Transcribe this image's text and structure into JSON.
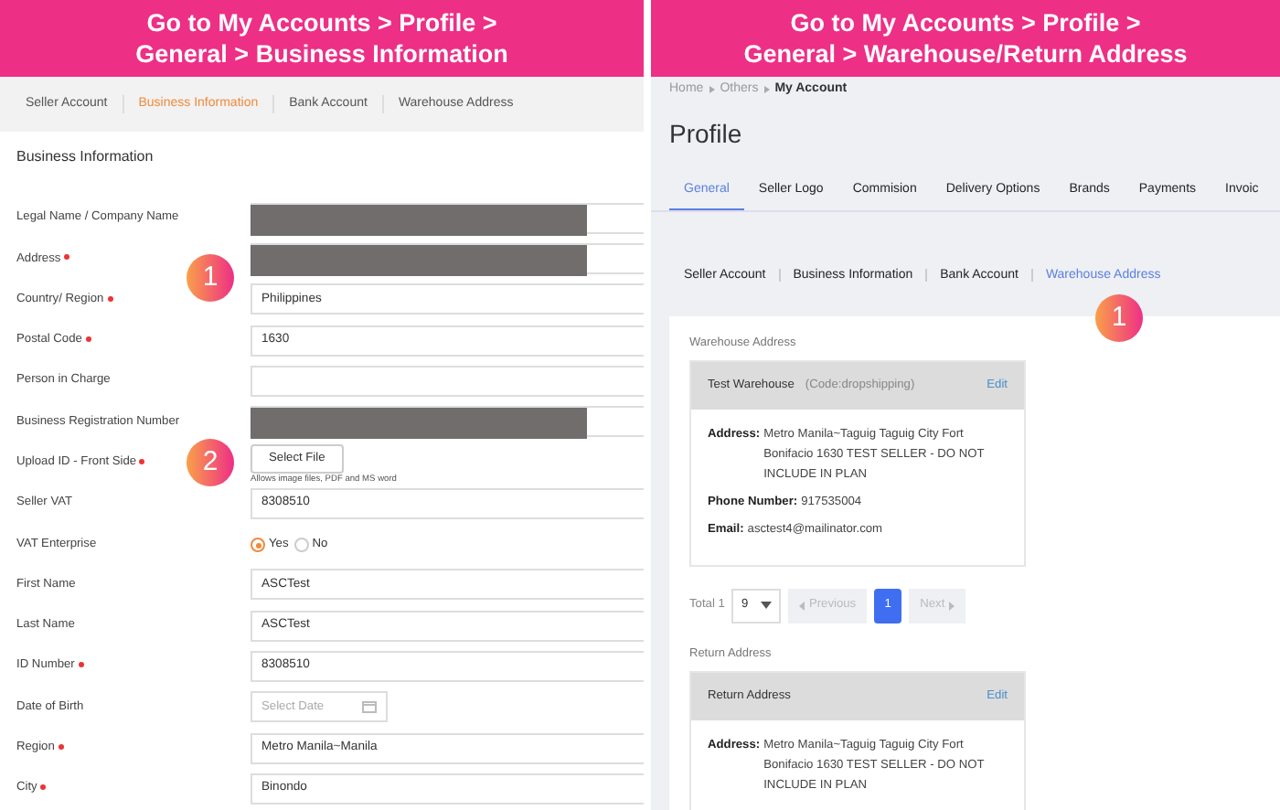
{
  "left_panel": {
    "header": [
      "Go to My Accounts > Profile >",
      "General > Business Information"
    ],
    "subtabs": [
      {
        "label": "Seller Account",
        "selected": false
      },
      {
        "label": "Business Information",
        "selected": true
      },
      {
        "label": "Bank Account",
        "selected": false
      },
      {
        "label": "Warehouse Address",
        "selected": false
      }
    ],
    "form_title": "Business Information",
    "fields": [
      {
        "label": "Legal Name / Company Name",
        "required": false,
        "kind": "redacted"
      },
      {
        "label": "Address",
        "required": true,
        "kind": "redacted",
        "step": "1"
      },
      {
        "label": "Country/ Region",
        "required": true,
        "kind": "text",
        "value": "Philippines"
      },
      {
        "label": "Postal Code",
        "required": true,
        "kind": "text",
        "value": "1630"
      },
      {
        "label": "Person in Charge",
        "required": false,
        "kind": "text"
      },
      {
        "label": "Business Registration Number",
        "required": false,
        "kind": "redacted"
      },
      {
        "label": "Upload ID - Front Side",
        "required": true,
        "kind": "file",
        "button": "Select File",
        "hint": "Allows image files, PDF and MS word",
        "step": "2"
      },
      {
        "label": "Seller VAT",
        "required": false,
        "kind": "text",
        "value": "8308510"
      },
      {
        "label": "VAT Enterprise",
        "required": false,
        "kind": "radio",
        "options": [
          {
            "label": "Yes",
            "selected": true
          },
          {
            "label": "No",
            "selected": false
          }
        ]
      },
      {
        "label": "First Name",
        "required": false,
        "kind": "text",
        "value": "ASCTest"
      },
      {
        "label": "Last Name",
        "required": false,
        "kind": "text",
        "value": "ASCTest"
      },
      {
        "label": "ID Number",
        "required": true,
        "kind": "text",
        "value": "8308510"
      },
      {
        "label": "Date of Birth",
        "required": false,
        "kind": "date",
        "placeholder": "Select Date"
      },
      {
        "label": "Region",
        "required": true,
        "kind": "text",
        "value": "Metro Manila~Manila"
      },
      {
        "label": "City",
        "required": true,
        "kind": "text",
        "value": "Binondo"
      }
    ]
  },
  "right_panel": {
    "header": [
      "Go to My Accounts > Profile >",
      "General > Warehouse/Return Address"
    ],
    "breadcrumb": [
      {
        "label": "Home",
        "current": false
      },
      {
        "label": "Others",
        "current": false
      },
      {
        "label": "My Account",
        "current": true
      }
    ],
    "title": "Profile",
    "tabs": [
      {
        "label": "General",
        "selected": true
      },
      {
        "label": "Seller Logo",
        "selected": false
      },
      {
        "label": "Commision",
        "selected": false
      },
      {
        "label": "Delivery Options",
        "selected": false
      },
      {
        "label": "Brands",
        "selected": false
      },
      {
        "label": "Payments",
        "selected": false
      },
      {
        "label": "Invoic",
        "selected": false
      }
    ],
    "subtabs": [
      {
        "label": "Seller Account",
        "selected": false
      },
      {
        "label": "Business Information",
        "selected": false
      },
      {
        "label": "Bank Account",
        "selected": false
      },
      {
        "label": "Warehouse Address",
        "selected": true,
        "step": "1"
      }
    ],
    "sections": [
      {
        "title": "Warehouse Address",
        "card": {
          "name": "Test Warehouse",
          "code": "(Code:dropshipping)",
          "edit": "Edit",
          "lines": [
            {
              "label": "Address:",
              "value": "Metro Manila~Taguig Taguig City Fort Bonifacio 1630 TEST SELLER - DO NOT INCLUDE IN PLAN"
            },
            {
              "label": "Phone Number:",
              "value": "917535004"
            },
            {
              "label": "Email:",
              "value": "asctest4@mailinator.com"
            }
          ]
        },
        "pagination": {
          "total": "Total 1",
          "page_size": "9",
          "previous": "Previous",
          "next": "Next",
          "pages": [
            {
              "label": "1",
              "selected": true
            }
          ]
        }
      },
      {
        "title": "Return Address",
        "card": {
          "name": "Return Address",
          "edit": "Edit",
          "lines": [
            {
              "label": "Address:",
              "value": "Metro Manila~Taguig Taguig City Fort Bonifacio 1630 TEST SELLER - DO NOT INCLUDE IN PLAN"
            }
          ]
        }
      }
    ]
  }
}
